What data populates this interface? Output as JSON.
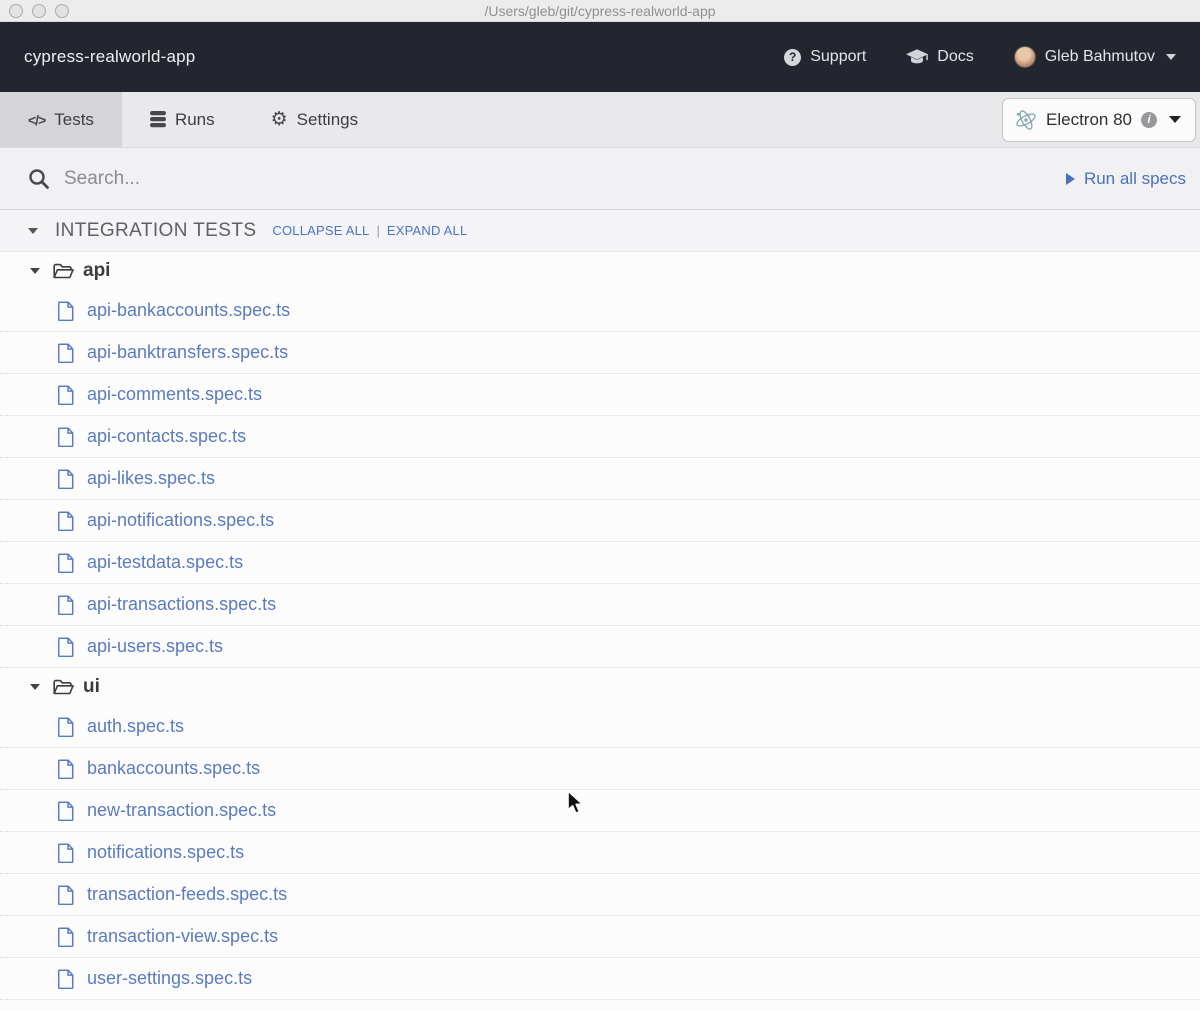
{
  "window": {
    "title": "/Users/gleb/git/cypress-realworld-app"
  },
  "navbar": {
    "project_name": "cypress-realworld-app",
    "support_label": "Support",
    "docs_label": "Docs",
    "user_name": "Gleb Bahmutov"
  },
  "tabbar": {
    "tabs": [
      {
        "label": "Tests",
        "icon": "code-icon",
        "active": true
      },
      {
        "label": "Runs",
        "icon": "database-icon",
        "active": false
      },
      {
        "label": "Settings",
        "icon": "gear-icon",
        "active": false
      }
    ],
    "browser": {
      "label": "Electron 80",
      "icon": "electron-icon",
      "info": "i"
    }
  },
  "toolbar": {
    "search_placeholder": "Search...",
    "run_all_label": "Run all specs"
  },
  "spec_list": {
    "section_title": "INTEGRATION TESTS",
    "collapse_all_label": "COLLAPSE ALL",
    "separator": "|",
    "expand_all_label": "EXPAND ALL",
    "folders": [
      {
        "name": "api",
        "specs": [
          "api-bankaccounts.spec.ts",
          "api-banktransfers.spec.ts",
          "api-comments.spec.ts",
          "api-contacts.spec.ts",
          "api-likes.spec.ts",
          "api-notifications.spec.ts",
          "api-testdata.spec.ts",
          "api-transactions.spec.ts",
          "api-users.spec.ts"
        ]
      },
      {
        "name": "ui",
        "specs": [
          "auth.spec.ts",
          "bankaccounts.spec.ts",
          "new-transaction.spec.ts",
          "notifications.spec.ts",
          "transaction-feeds.spec.ts",
          "transaction-view.spec.ts",
          "user-settings.spec.ts"
        ]
      }
    ]
  },
  "colors": {
    "navbar_bg": "#23252f",
    "spec_link_blue": "#5b7bbd",
    "action_link_blue": "#4a72b8",
    "active_tab_bg": "#d5d5d7",
    "tabbar_bg": "#e9e9eb"
  }
}
